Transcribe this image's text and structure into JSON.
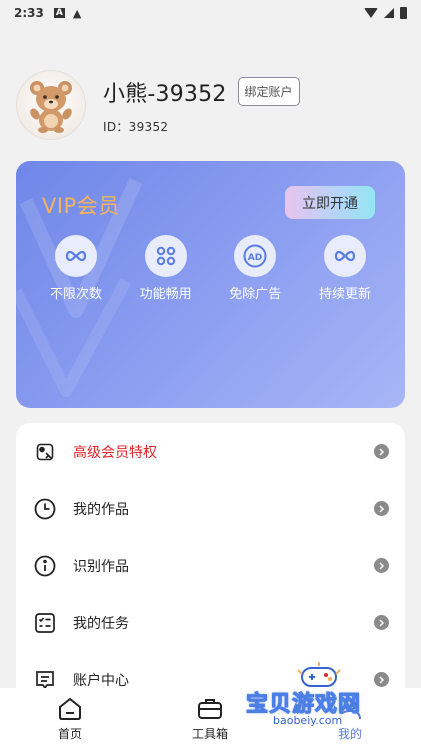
{
  "status_bar": {
    "time": "2:33",
    "notif_a": "A",
    "notif_warn": "▲"
  },
  "profile": {
    "username": "小熊-39352",
    "bind_label": "绑定账户",
    "user_id": "ID：39352"
  },
  "vip": {
    "title": "VIP会员",
    "button_label": "立即开通",
    "features": [
      {
        "label": "不限次数",
        "icon": "infinity-icon"
      },
      {
        "label": "功能畅用",
        "icon": "grid-icon"
      },
      {
        "label": "免除广告",
        "icon": "ad-free-icon"
      },
      {
        "label": "持续更新",
        "icon": "infinity-icon"
      }
    ]
  },
  "menu": {
    "items": [
      {
        "label": "高级会员特权",
        "icon": "privilege-icon"
      },
      {
        "label": "我的作品",
        "icon": "clock-icon"
      },
      {
        "label": "识别作品",
        "icon": "info-icon"
      },
      {
        "label": "我的任务",
        "icon": "task-list-icon"
      },
      {
        "label": "账户中心",
        "icon": "account-icon"
      }
    ]
  },
  "tabs": [
    {
      "label": "首页",
      "icon": "home-icon"
    },
    {
      "label": "工具箱",
      "icon": "toolbox-icon"
    },
    {
      "label": "我的",
      "icon": "profile-icon"
    }
  ],
  "watermark": {
    "text": "宝贝游戏网",
    "url": "baobeiy.com"
  },
  "colors": {
    "vip_accent": "#f6b35b",
    "highlight_red": "#e0262b",
    "card_blue": "#6f87e8"
  }
}
